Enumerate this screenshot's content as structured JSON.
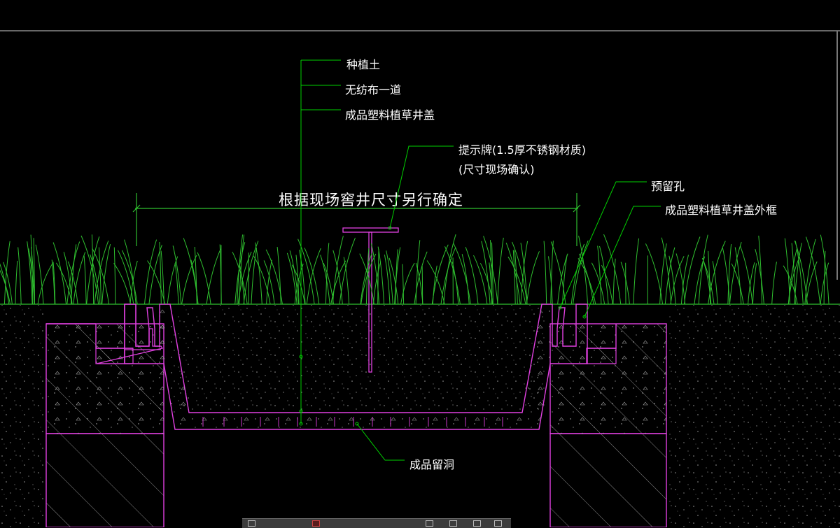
{
  "labels": {
    "soil": "种植土",
    "fabric": "无纺布一道",
    "cover": "成品塑料植草井盖",
    "sign_line1": "提示牌(1.5厚不锈钢材质)",
    "sign_line2": "(尺寸现场确认)",
    "dimension": "根据现场窖井尺寸另行确定",
    "reserved_hole": "预留孔",
    "cover_frame": "成品塑料植草井盖外框",
    "drain_hole": "成品留洞"
  },
  "colors": {
    "background": "#000000",
    "structure": "#e040e0",
    "leader": "#00d000",
    "grass": "#2fbf2f",
    "text": "#ffffff",
    "hatch": "#8a8a8a"
  }
}
